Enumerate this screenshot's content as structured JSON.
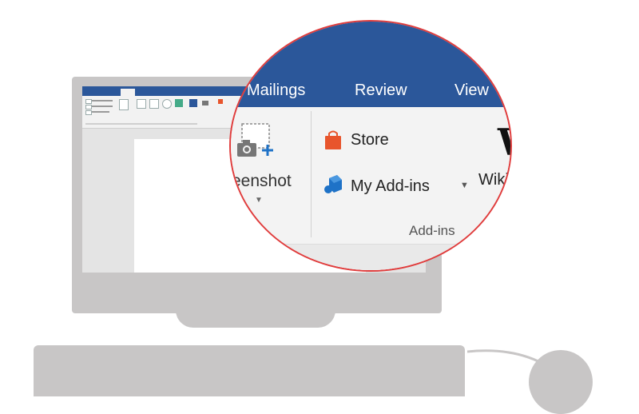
{
  "ribbon": {
    "tabs": [
      {
        "label": "Mailings"
      },
      {
        "label": "Review"
      },
      {
        "label": "View"
      }
    ]
  },
  "illustrations_group": {
    "screenshot_label": "reenshot"
  },
  "addins_group": {
    "store_label": "Store",
    "my_addins_label": "My Add-ins",
    "wiki_label": "Wiki",
    "group_label": "Add-ins"
  },
  "colors": {
    "ribbon_blue": "#2b579a",
    "magnifier_border": "#e03c3c",
    "store_orange": "#e8552c",
    "addins_blue": "#1e72c7",
    "device_gray": "#c8c6c6"
  },
  "icons": [
    "screenshot-icon",
    "store-icon",
    "addins-icon",
    "chevron-down-icon",
    "wikipedia-icon"
  ]
}
